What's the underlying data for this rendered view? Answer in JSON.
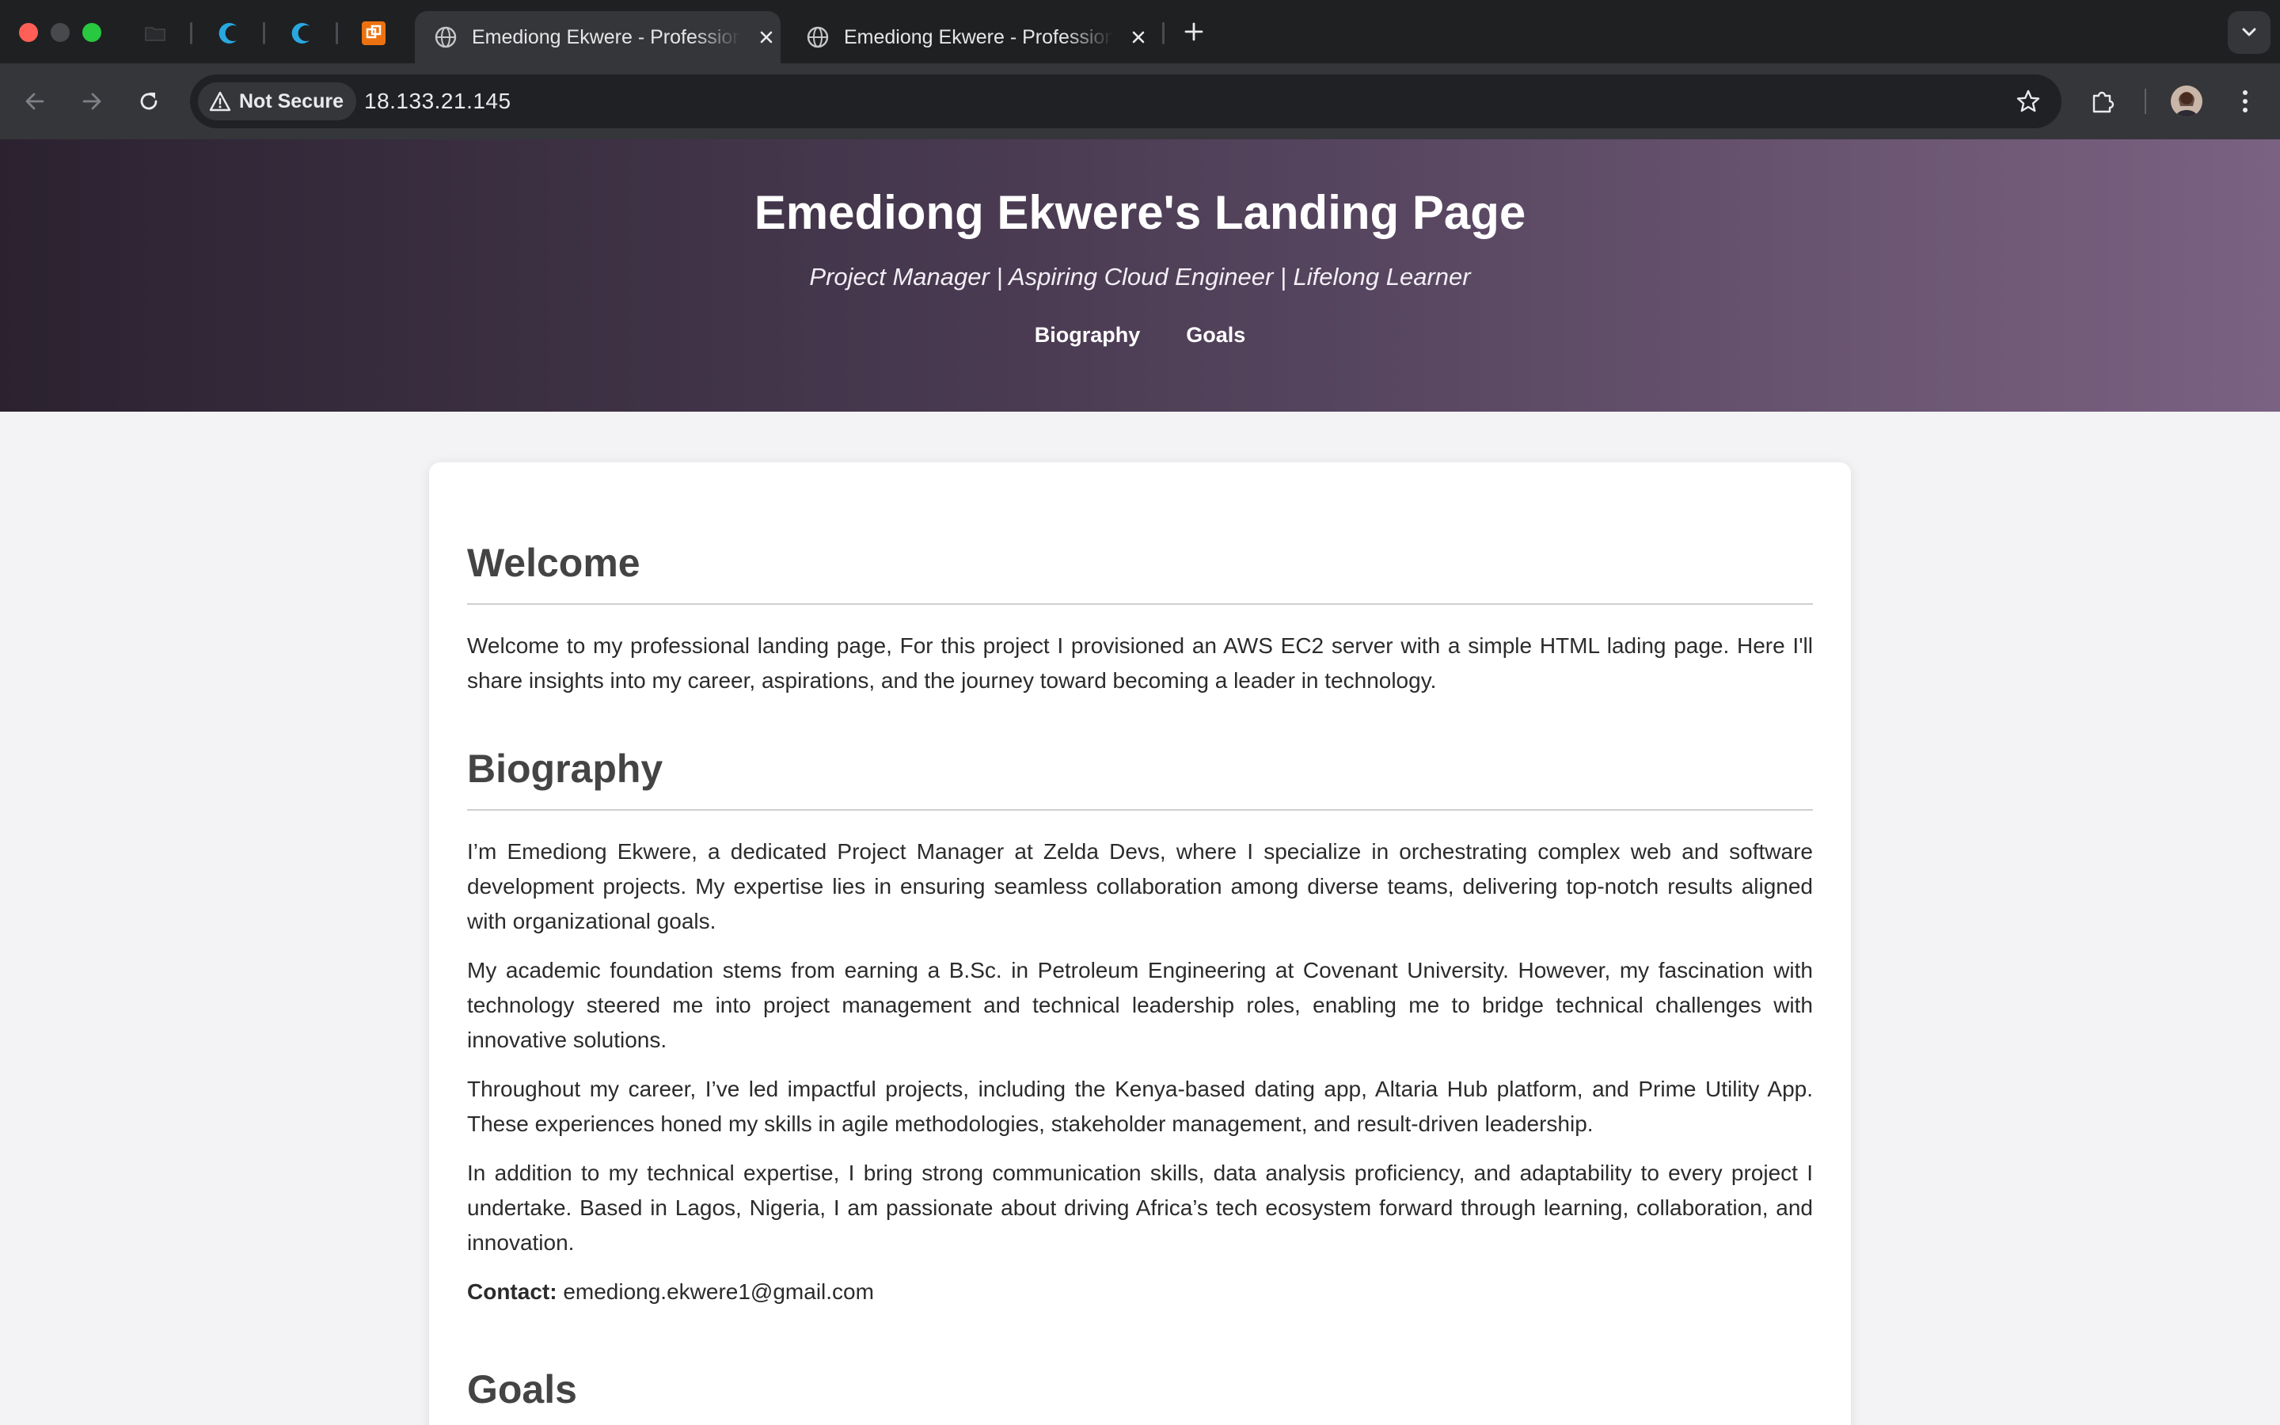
{
  "browser": {
    "tabs": [
      {
        "title": "Emediong Ekwere - Professional Landing Page",
        "active": true
      },
      {
        "title": "Emediong Ekwere - Professional Landing Page",
        "active": false
      }
    ],
    "security_chip": "Not Secure",
    "url": "18.133.21.145"
  },
  "hero": {
    "title": "Emediong Ekwere's Landing Page",
    "tagline": "Project Manager | Aspiring Cloud Engineer | Lifelong Learner",
    "nav": [
      "Biography",
      "Goals"
    ]
  },
  "welcome": {
    "heading": "Welcome",
    "text": "Welcome to my professional landing page, For this project I provisioned an AWS EC2 server with a simple HTML lading page. Here I'll share insights into my career, aspirations, and the journey toward becoming a leader in technology."
  },
  "biography": {
    "heading": "Biography",
    "paragraphs": [
      "I’m Emediong Ekwere, a dedicated Project Manager at Zelda Devs, where I specialize in orchestrating complex web and software development projects. My expertise lies in ensuring seamless collaboration among diverse teams, delivering top-notch results aligned with organizational goals.",
      "My academic foundation stems from earning a B.Sc. in Petroleum Engineering at Covenant University. However, my fascination with technology steered me into project management and technical leadership roles, enabling me to bridge technical challenges with innovative solutions.",
      "Throughout my career, I’ve led impactful projects, including the Kenya-based dating app, Altaria Hub platform, and Prime Utility App. These experiences honed my skills in agile methodologies, stakeholder management, and result-driven leadership.",
      "In addition to my technical expertise, I bring strong communication skills, data analysis proficiency, and adaptability to every project I undertake. Based in Lagos, Nigeria, I am passionate about driving Africa’s tech ecosystem forward through learning, collaboration, and innovation."
    ],
    "contact_label": "Contact:",
    "contact_email": "emediong.ekwere1@gmail.com"
  },
  "goals": {
    "heading": "Goals"
  },
  "colors": {
    "hero_gradient_start": "#2b2230",
    "hero_gradient_end": "#7a6282",
    "page_background": "#f3f3f5",
    "heading": "#444444"
  }
}
